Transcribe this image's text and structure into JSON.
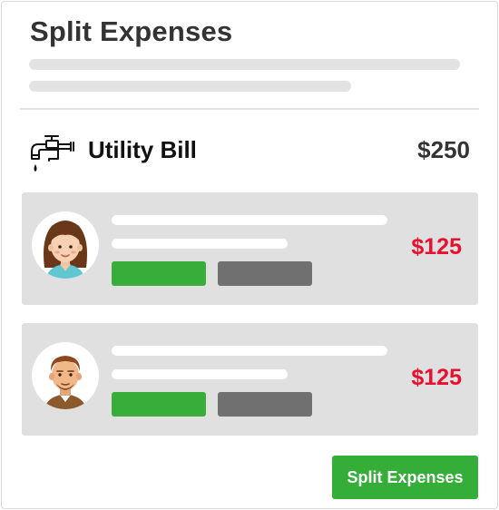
{
  "header": {
    "title": "Split Expenses"
  },
  "bill": {
    "icon": "faucet-icon",
    "label": "Utility Bill",
    "amount": "$250"
  },
  "people": [
    {
      "avatar": "woman-avatar",
      "share": "$125"
    },
    {
      "avatar": "man-avatar",
      "share": "$125"
    }
  ],
  "actions": {
    "split_label": "Split Expenses"
  },
  "colors": {
    "accent_green": "#35ae39",
    "share_red": "#e8102e",
    "chip_gray": "#707070",
    "row_background": "#e0e0e0"
  }
}
